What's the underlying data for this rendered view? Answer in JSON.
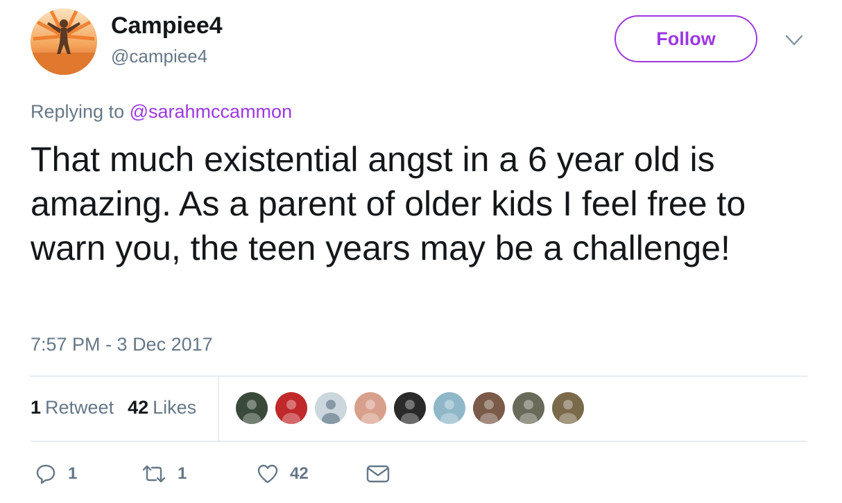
{
  "user": {
    "display_name": "Campiee4",
    "handle": "@campiee4",
    "follow_label": "Follow"
  },
  "reply": {
    "prefix": "Replying to",
    "mention": "@sarahmccammon"
  },
  "tweet": {
    "text": "That much existential angst in a 6 year old is amazing. As a parent of older kids I feel free to warn you, the teen years may be a challenge!",
    "timestamp": "7:57 PM - 3 Dec 2017"
  },
  "stats": {
    "retweets_count": "1",
    "retweets_label": "Retweet",
    "likes_count": "42",
    "likes_label": "Likes"
  },
  "likers": [
    {
      "name": "liker-1",
      "color": "#3a4a3a"
    },
    {
      "name": "liker-2",
      "color": "#c0282a"
    },
    {
      "name": "liker-3",
      "color": "#ccd6dd"
    },
    {
      "name": "liker-4",
      "color": "#d8a08c"
    },
    {
      "name": "liker-5",
      "color": "#2a2a2a"
    },
    {
      "name": "liker-6",
      "color": "#8fb7c8"
    },
    {
      "name": "liker-7",
      "color": "#7a5a48"
    },
    {
      "name": "liker-8",
      "color": "#6a6a5a"
    },
    {
      "name": "liker-9",
      "color": "#7a6a4a"
    }
  ],
  "actions": {
    "reply_count": "1",
    "retweet_count": "1",
    "like_count": "42"
  },
  "colors": {
    "accent": "#9b38e0",
    "muted": "#657786",
    "text": "#14171a"
  }
}
